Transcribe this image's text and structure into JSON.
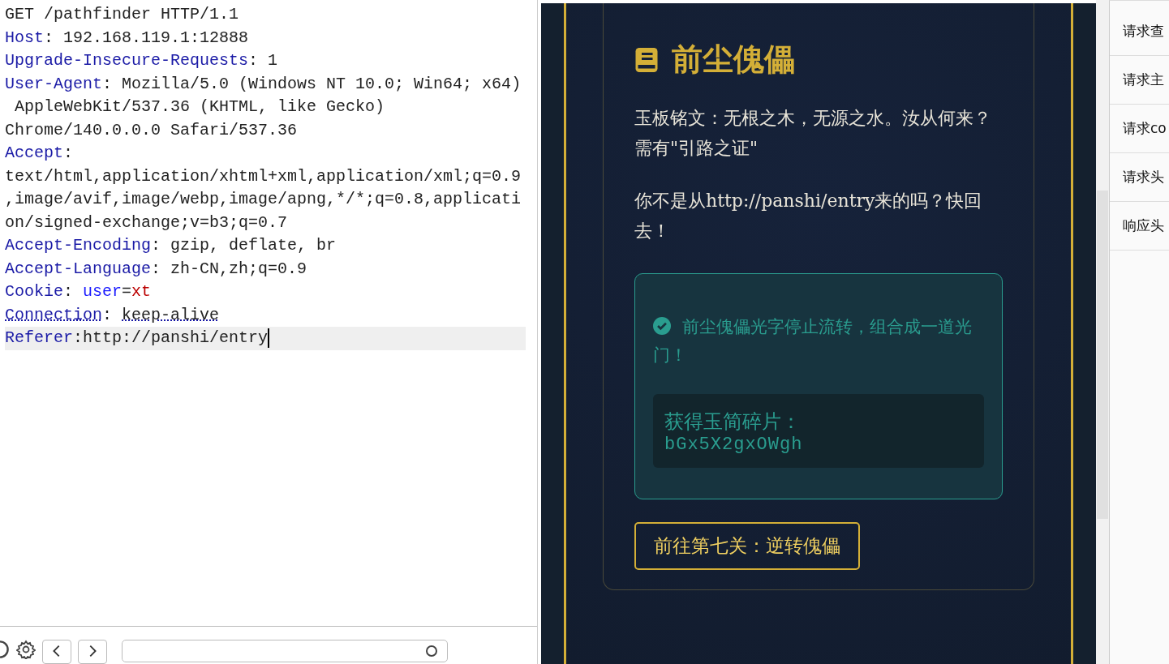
{
  "request_editor": {
    "request_line": "GET /pathfinder HTTP/1.1",
    "headers": [
      {
        "name": "Host",
        "separator": ": ",
        "value": [
          "192.168.119.1:12888"
        ],
        "flagged": false,
        "current": false
      },
      {
        "name": "Upgrade-Insecure-Requests",
        "separator": ": ",
        "value": [
          "1"
        ],
        "flagged": false,
        "current": false
      },
      {
        "name": "User-Agent",
        "separator": ": ",
        "value": [
          "Mozilla/5.0 (Windows NT 10.0; Win64; x64)",
          " AppleWebKit/537.36 (KHTML, like Gecko)",
          "Chrome/140.0.0.0 Safari/537.36"
        ],
        "flagged": false,
        "current": false
      },
      {
        "name": "Accept",
        "separator": ":",
        "value_on_next_line": true,
        "value": [
          "text/html,application/xhtml+xml,application/xml;q=0.9",
          ",image/avif,image/webp,image/apng,*/*;q=0.8,applicati",
          "on/signed-exchange;v=b3;q=0.7"
        ],
        "flagged": false,
        "current": false
      },
      {
        "name": "Accept-Encoding",
        "separator": ": ",
        "value": [
          "gzip, deflate, br"
        ],
        "flagged": false,
        "current": false
      },
      {
        "name": "Accept-Language",
        "separator": ": ",
        "value": [
          "zh-CN,zh;q=0.9"
        ],
        "flagged": false,
        "current": false
      },
      {
        "name": "Cookie",
        "separator": ": ",
        "params": [
          {
            "name": "user",
            "separator": "=",
            "value": "xt"
          }
        ],
        "flagged": false,
        "current": false
      },
      {
        "name": "Connection",
        "separator": ": ",
        "value": [
          "keep-alive"
        ],
        "flagged": true,
        "current": false
      },
      {
        "name": "Referer",
        "separator": ":",
        "value": [
          "http://panshi/entry"
        ],
        "flagged": false,
        "current": true
      }
    ]
  },
  "page": {
    "title": "前尘傀儡",
    "paragraphs": [
      "玉板铭文：无根之木，无源之水。汝从何来？需有\"引路之证\"",
      "你不是从http://panshi/entry来的吗？快回去！"
    ],
    "result": {
      "message": "前尘傀儡光字停止流转，组合成一道光门！",
      "reward_label": "获得玉简碎片：",
      "reward_code": "bGx5X2gxOWgh"
    },
    "next_button": "前往第七关：逆转傀儡"
  },
  "inspector": {
    "items": [
      {
        "label": "请求查"
      },
      {
        "label": "请求主"
      },
      {
        "label": "请求co"
      },
      {
        "label": "请求头"
      },
      {
        "label": "响应头"
      }
    ]
  }
}
